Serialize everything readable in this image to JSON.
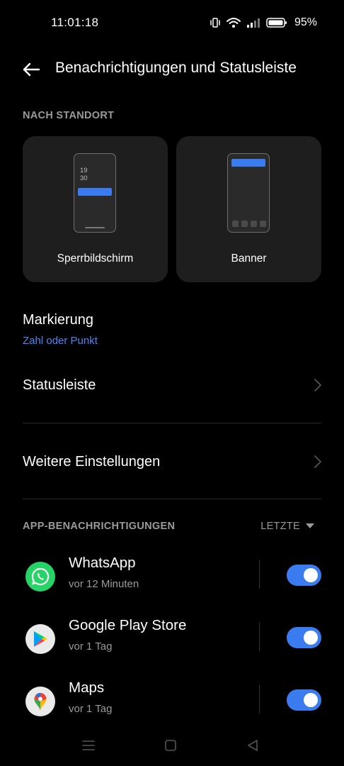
{
  "status_bar": {
    "time": "11:01:18",
    "battery_percent": "95%",
    "icons": [
      "vibrate-icon",
      "wifi-icon",
      "signal-icon",
      "battery-icon"
    ]
  },
  "header": {
    "title": "Benachrichtigungen und Statusleiste",
    "back_icon": "arrow-left-icon"
  },
  "location_section": {
    "label": "NACH STANDORT",
    "cards": [
      {
        "label": "Sperrbildschirm",
        "preview_clock": [
          "19",
          "30"
        ]
      },
      {
        "label": "Banner"
      }
    ]
  },
  "settings": {
    "markierung": {
      "title": "Markierung",
      "value": "Zahl oder Punkt"
    },
    "statusleiste": {
      "title": "Statusleiste"
    },
    "weitere": {
      "title": "Weitere Einstellungen"
    }
  },
  "app_notifications": {
    "label": "APP-BENACHRICHTIGUNGEN",
    "sort_label": "LETZTE",
    "apps": [
      {
        "name": "WhatsApp",
        "time": "vor 12 Minuten",
        "enabled": true
      },
      {
        "name": "Google Play Store",
        "time": "vor 1 Tag",
        "enabled": true
      },
      {
        "name": "Maps",
        "time": "vor 1 Tag",
        "enabled": true
      }
    ]
  },
  "colors": {
    "accent": "#3a7cf0",
    "link": "#4f86f7",
    "background": "#000000",
    "card": "#1e1e1e"
  },
  "nav_bar": [
    "menu-icon",
    "home-square-icon",
    "back-triangle-icon"
  ]
}
